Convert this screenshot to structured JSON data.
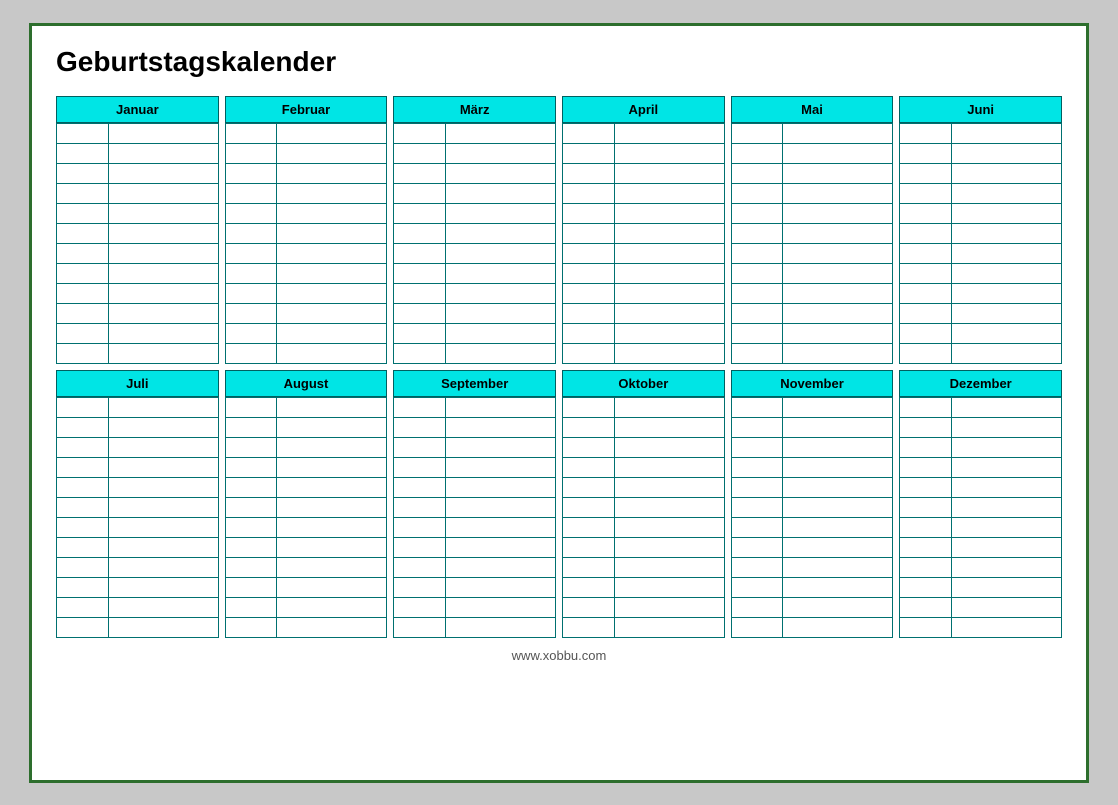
{
  "title": "Geburtstagskalender",
  "months_row1": [
    {
      "label": "Januar"
    },
    {
      "label": "Februar"
    },
    {
      "label": "März"
    },
    {
      "label": "April"
    },
    {
      "label": "Mai"
    },
    {
      "label": "Juni"
    }
  ],
  "months_row2": [
    {
      "label": "Juli"
    },
    {
      "label": "August"
    },
    {
      "label": "September"
    },
    {
      "label": "Oktober"
    },
    {
      "label": "November"
    },
    {
      "label": "Dezember"
    }
  ],
  "rows": 12,
  "footer": "www.xobbu.com"
}
